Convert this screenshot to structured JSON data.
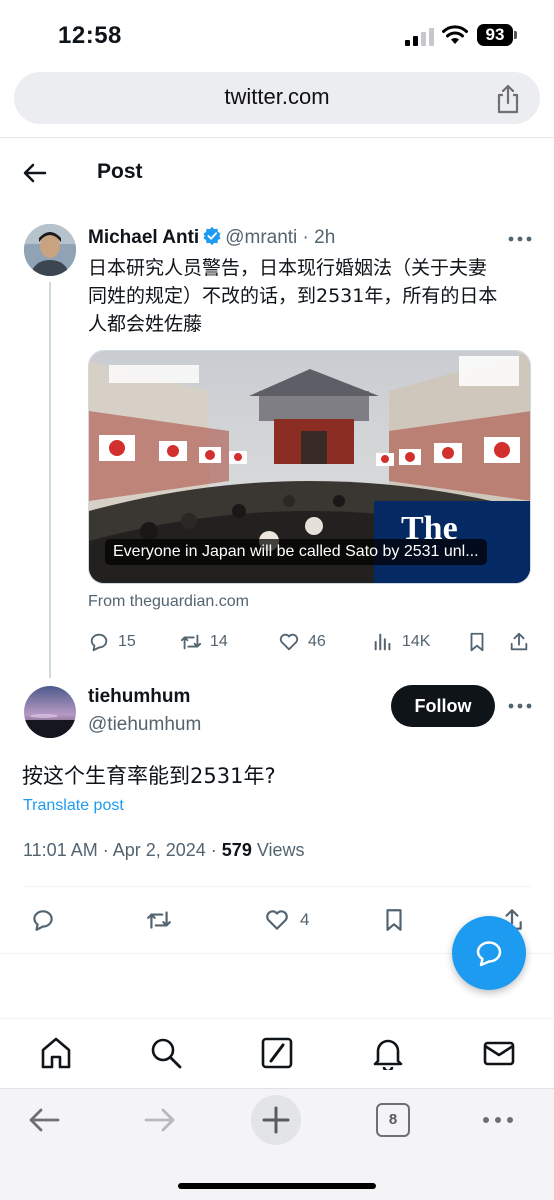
{
  "status": {
    "time": "12:58",
    "battery": "93"
  },
  "browser": {
    "url": "twitter.com",
    "tab_count": "8"
  },
  "header": {
    "title": "Post"
  },
  "tweet": {
    "author_name": "Michael Anti",
    "handle": "@mranti",
    "time_ago": "2h",
    "text_lines": [
      "日本研究人员警告，日本现行婚姻法（关于夫妻",
      "同姓的规定）不改的话，到2531年，所有的日本",
      "人都会姓佐藤"
    ],
    "card_caption": "Everyone in Japan will be called Sato by 2531 unl...",
    "card_source": "From theguardian.com",
    "replies": "15",
    "retweets": "14",
    "likes": "46",
    "views": "14K"
  },
  "reply": {
    "author_name": "tiehumhum",
    "handle": "@tiehumhum",
    "follow_label": "Follow",
    "text": "按这个生育率能到2531年?",
    "translate_label": "Translate post",
    "timestamp": "11:01 AM · Apr 2, 2024 · ",
    "views_count": "579",
    "views_label": " Views",
    "likes": "4"
  },
  "colors": {
    "accent": "#1d9bf0",
    "text_primary": "#0f1419",
    "text_secondary": "#536471"
  }
}
